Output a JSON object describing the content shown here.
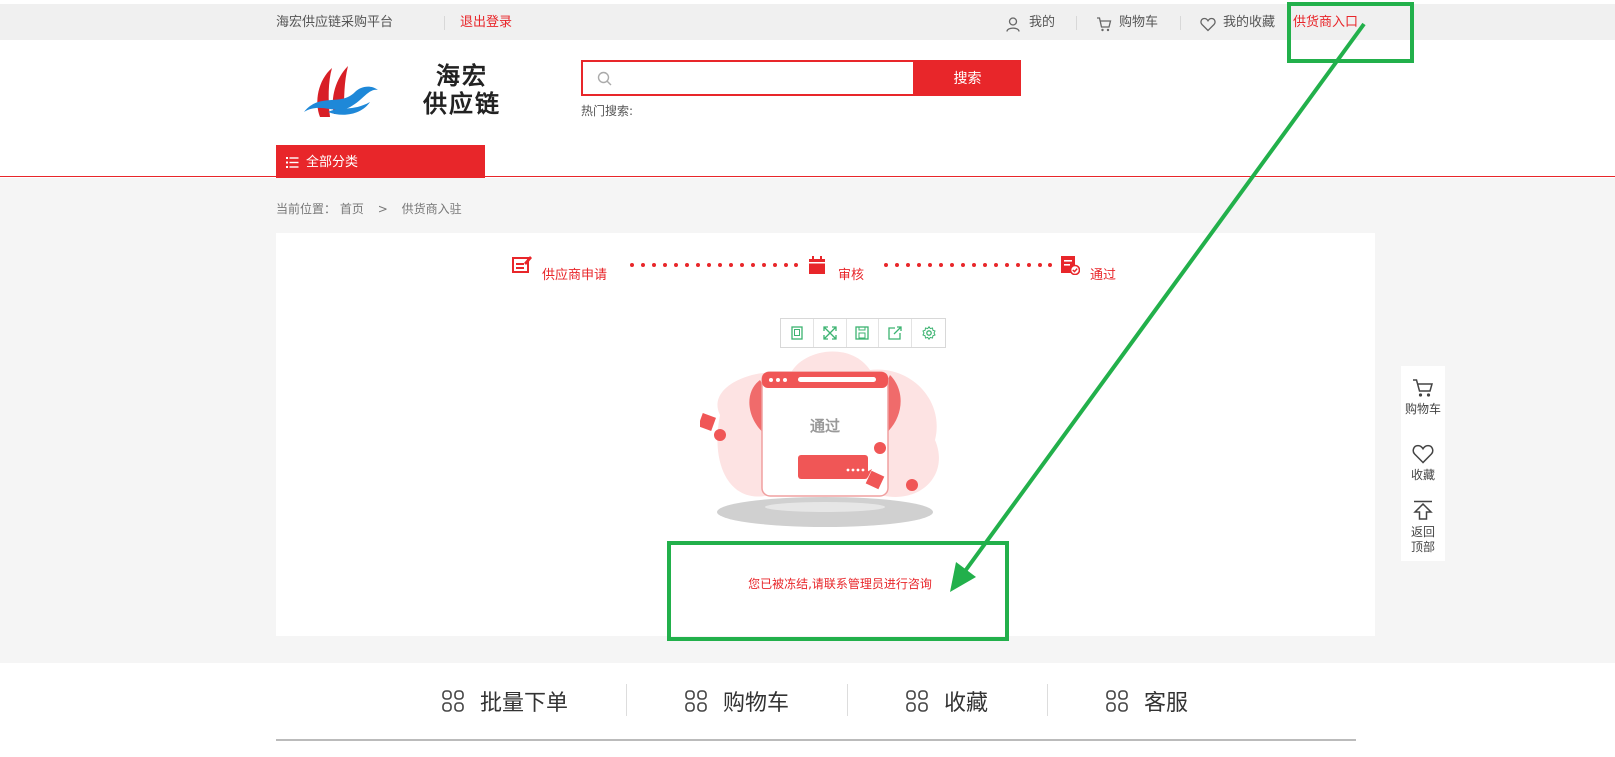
{
  "topbar": {
    "platform_name": "海宏供应链采购平台",
    "logout": "退出登录",
    "my": "我的",
    "cart": "购物车",
    "favorites": "我的收藏",
    "supplier_entry": "供货商入口"
  },
  "header": {
    "logo_line1": "海宏",
    "logo_line2": "供应链",
    "search_placeholder": "",
    "search_button": "搜索",
    "hot_search": "热门搜索:",
    "all_categories": "全部分类"
  },
  "breadcrumb": {
    "prefix": "当前位置：",
    "home": "首页",
    "current": "供货商入驻"
  },
  "steps": [
    {
      "label": "供应商申请"
    },
    {
      "label": "审核"
    },
    {
      "label": "通过"
    }
  ],
  "illustration": {
    "label": "通过",
    "button_text": "...."
  },
  "message": "您已被冻结,请联系管理员进行咨询",
  "side_float": {
    "cart": "购物车",
    "favorite": "收藏",
    "back_top_1": "返回",
    "back_top_2": "顶部"
  },
  "footer": [
    {
      "label": "批量下单"
    },
    {
      "label": "购物车"
    },
    {
      "label": "收藏"
    },
    {
      "label": "客服"
    }
  ],
  "colors": {
    "brand_red": "#e8262a",
    "annotation_green": "#22b04b"
  }
}
